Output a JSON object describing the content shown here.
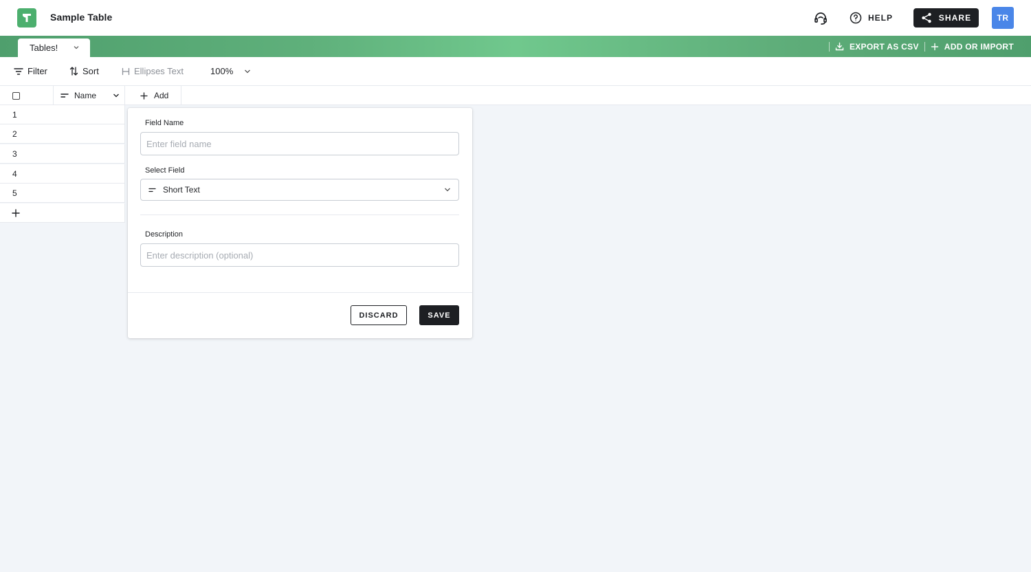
{
  "app": {
    "title": "Sample Table",
    "logo_letter": "T",
    "colors": {
      "brand": "#4caf6e",
      "dark": "#1d1f23",
      "avatar": "#4a86e8",
      "background": "#f2f5f9"
    }
  },
  "header": {
    "support_icon": "headset-icon",
    "help_label": "HELP",
    "share_label": "SHARE",
    "avatar_initials": "TR"
  },
  "tabbar": {
    "active_tab": "Tables!",
    "export_label": "EXPORT AS CSV",
    "add_import_label": "ADD OR IMPORT"
  },
  "toolbar": {
    "filter_label": "Filter",
    "sort_label": "Sort",
    "ellipses_label": "Ellipses Text",
    "zoom_value": "100%"
  },
  "grid": {
    "columns": [
      {
        "label": "Name",
        "icon": "short-text-icon"
      }
    ],
    "add_column_label": "Add",
    "rows": [
      "1",
      "2",
      "3",
      "4",
      "5"
    ]
  },
  "field_popover": {
    "field_name_label": "Field Name",
    "field_name_placeholder": "Enter field name",
    "field_name_value": "",
    "select_field_label": "Select Field",
    "select_field_value": "Short Text",
    "description_label": "Description",
    "description_placeholder": "Enter description (optional)",
    "description_value": "",
    "discard_label": "DISCARD",
    "save_label": "SAVE"
  }
}
